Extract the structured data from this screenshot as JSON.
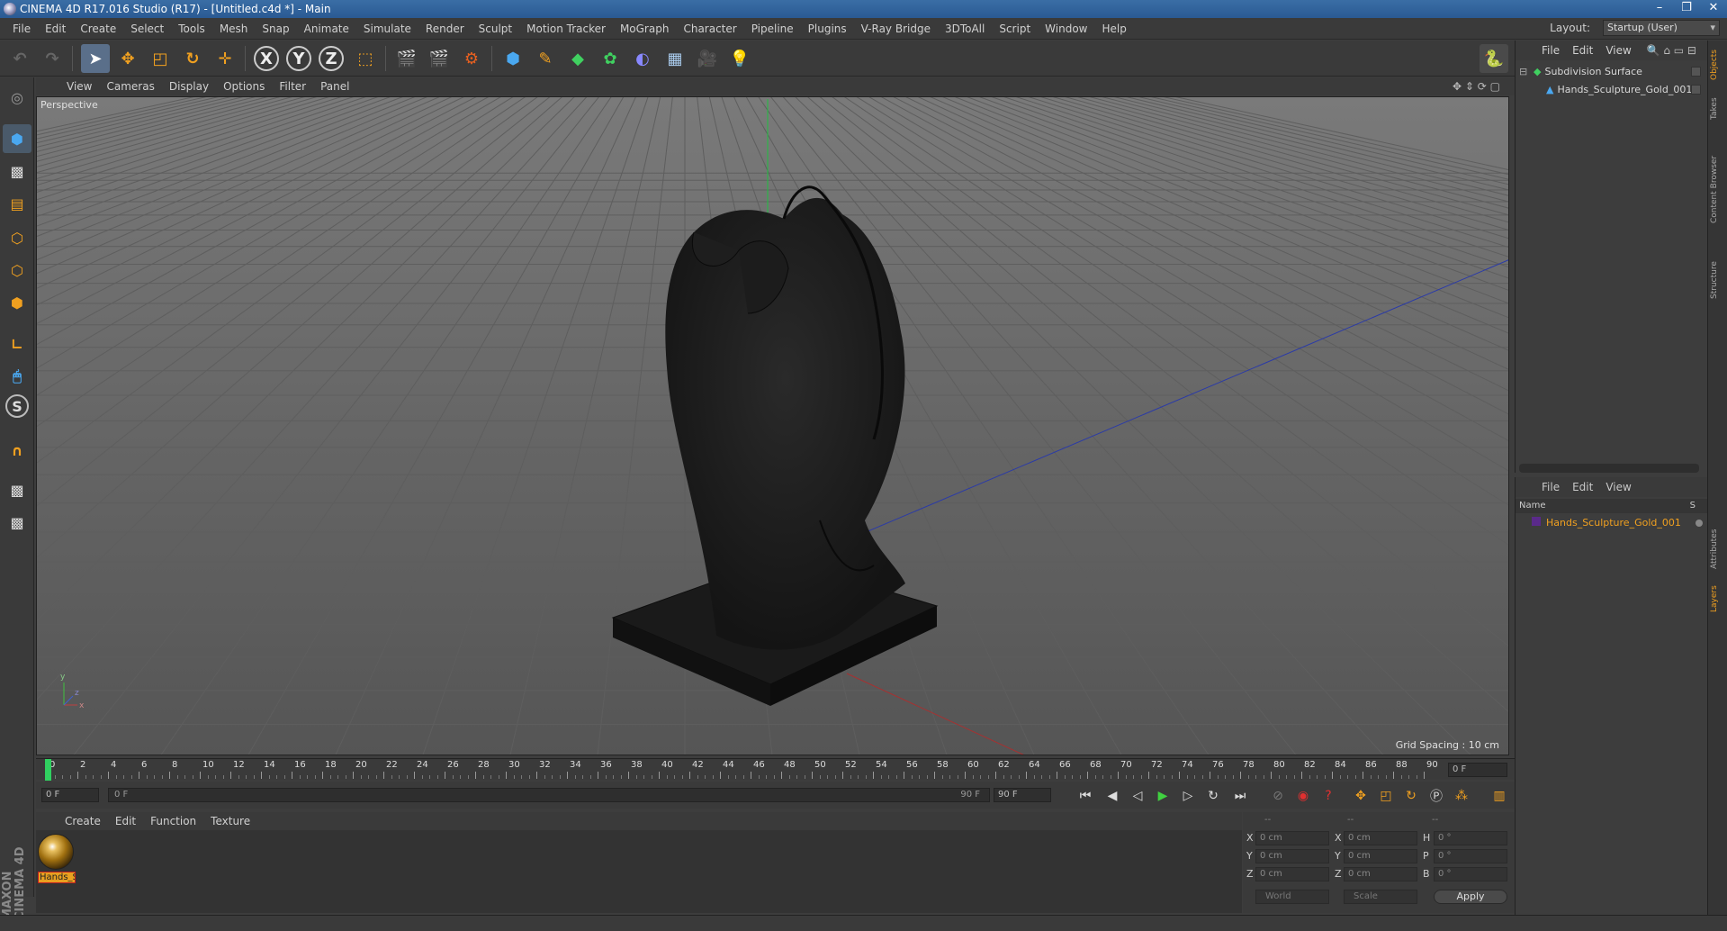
{
  "window": {
    "title": "CINEMA 4D R17.016 Studio (R17) - [Untitled.c4d *] - Main",
    "minimize": "–",
    "maximize": "❐",
    "close": "✕"
  },
  "menu": [
    "File",
    "Edit",
    "Create",
    "Select",
    "Tools",
    "Mesh",
    "Snap",
    "Animate",
    "Simulate",
    "Render",
    "Sculpt",
    "Motion Tracker",
    "MoGraph",
    "Character",
    "Pipeline",
    "Plugins",
    "V-Ray Bridge",
    "3DToAll",
    "Script",
    "Window",
    "Help"
  ],
  "layout": {
    "label": "Layout:",
    "value": "Startup (User)"
  },
  "toolbar": {
    "x_label": "X",
    "y_label": "Y",
    "z_label": "Z"
  },
  "viewport": {
    "menu": [
      "View",
      "Cameras",
      "Display",
      "Options",
      "Filter",
      "Panel"
    ],
    "label": "Perspective",
    "grid_spacing": "Grid Spacing : 10 cm",
    "axis_x": "x",
    "axis_y": "y",
    "axis_z": "z"
  },
  "timeline": {
    "ticks": [
      "0",
      "2",
      "4",
      "6",
      "8",
      "10",
      "12",
      "14",
      "16",
      "18",
      "20",
      "22",
      "24",
      "26",
      "28",
      "30",
      "32",
      "34",
      "36",
      "38",
      "40",
      "42",
      "44",
      "46",
      "48",
      "50",
      "52",
      "54",
      "56",
      "58",
      "60",
      "62",
      "64",
      "66",
      "68",
      "70",
      "72",
      "74",
      "76",
      "78",
      "80",
      "82",
      "84",
      "86",
      "88",
      "90"
    ],
    "current_frame": "0 F",
    "start_field": "0 F",
    "range_start": "0 F",
    "range_end": "90 F",
    "end_field": "90 F"
  },
  "material_manager": {
    "menu": [
      "Create",
      "Edit",
      "Function",
      "Texture"
    ],
    "materials": [
      {
        "label": "Hands_S"
      }
    ]
  },
  "coordinates": {
    "header": [
      "--",
      "--",
      "--"
    ],
    "rows": [
      {
        "a1": "X",
        "v1": "0 cm",
        "a2": "X",
        "v2": "0 cm",
        "a3": "H",
        "v3": "0 °"
      },
      {
        "a1": "Y",
        "v1": "0 cm",
        "a2": "Y",
        "v2": "0 cm",
        "a3": "P",
        "v3": "0 °"
      },
      {
        "a1": "Z",
        "v1": "0 cm",
        "a2": "Z",
        "v2": "0 cm",
        "a3": "B",
        "v3": "0 °"
      }
    ],
    "mode1": "World",
    "mode2": "Scale",
    "apply": "Apply"
  },
  "object_manager": {
    "menu": [
      "File",
      "Edit",
      "View"
    ],
    "objects": [
      {
        "name": "Subdivision Surface"
      },
      {
        "name": "Hands_Sculpture_Gold_001"
      }
    ]
  },
  "layer_manager": {
    "menu": [
      "File",
      "Edit",
      "View"
    ],
    "header_name": "Name",
    "header_s": "S",
    "items": [
      {
        "name": "Hands_Sculpture_Gold_001"
      }
    ]
  },
  "side_tabs": [
    "Objects",
    "Takes",
    "Content Browser",
    "Structure",
    "Attributes",
    "Layers"
  ],
  "branding": "MAXON CINEMA 4D"
}
